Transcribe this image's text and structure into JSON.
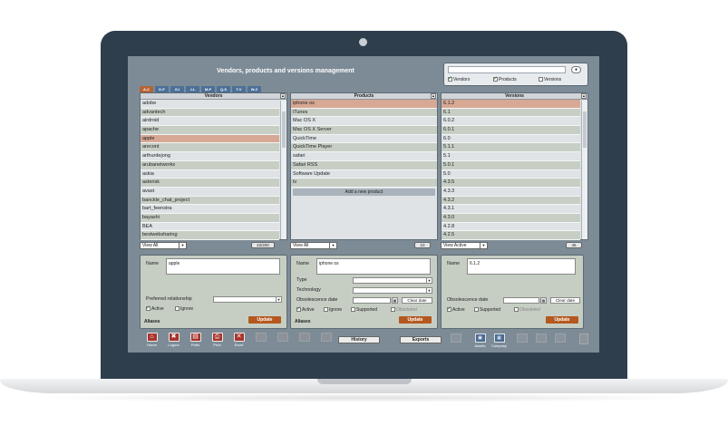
{
  "title": "Vendors, products and versions management",
  "search": {
    "go_label": "Go",
    "checks": [
      {
        "label": "Vendors",
        "checked": true
      },
      {
        "label": "Products",
        "checked": true
      },
      {
        "label": "Versions",
        "checked": false
      }
    ]
  },
  "alpha_tabs": [
    "A-C",
    "D-F",
    "G-I",
    "J-L",
    "M-P",
    "Q-S",
    "T-V",
    "W-Z"
  ],
  "vendors": {
    "header": "Vendors",
    "items": [
      "adobe",
      "advantech",
      "airdroid",
      "apache",
      "apple",
      "arecont",
      "arthurdejong",
      "arubanetworks",
      "askia",
      "asterisk",
      "avast",
      "banckle_chat_project",
      "bart_feenstra",
      "bayashi",
      "BEA",
      "bestwebsharing"
    ],
    "selected": "apple",
    "filter": "View All",
    "count": "42/200"
  },
  "products": {
    "header": "Products",
    "items": [
      "iphone os",
      "iTunes",
      "Mac OS X",
      "Mac OS X Server",
      "QuickTime",
      "QuickTime Player",
      "safari",
      "Safari RSS",
      "Software Update",
      "tv"
    ],
    "selected": "iphone os",
    "add_label": "Add a new product",
    "filter": "View All",
    "count": "10"
  },
  "versions": {
    "header": "Versions",
    "items": [
      "6.1.2",
      "6.1",
      "6.0.2",
      "6.0.1",
      "6.0",
      "5.1.1",
      "5.1",
      "5.0.1",
      "5.0",
      "4.3.5",
      "4.3.3",
      "4.3.2",
      "4.3.1",
      "4.3.0",
      "4.2.8",
      "4.2.5"
    ],
    "selected": "6.1.2",
    "filter": "View Active",
    "count": "46"
  },
  "vendor_form": {
    "name_label": "Name",
    "name_value": "apple",
    "pref_label": "Preferred relationship",
    "active_label": "Active",
    "ignore_label": "Ignore",
    "aliases_label": "Aliases",
    "update_label": "Update"
  },
  "product_form": {
    "name_label": "Name",
    "name_value": "iphone os",
    "type_label": "Type",
    "tech_label": "Technology",
    "obs_label": "Obsolescence date",
    "clear_label": "Clear date",
    "active_label": "Active",
    "ignore_label": "Ignore",
    "supported_label": "Supported",
    "obsoleted_label": "Obsoleted",
    "aliases_label": "Aliases",
    "update_label": "Update"
  },
  "version_form": {
    "name_label": "Name",
    "name_value": "6.1.2",
    "obs_label": "Obsolescence date",
    "clear_label": "Clear date",
    "active_label": "Active",
    "supported_label": "Supported",
    "obsoleted_label": "Obsoleted",
    "update_label": "Update"
  },
  "toolbar": {
    "buttons": [
      {
        "label": "Home",
        "icon": "home-icon",
        "enabled": true
      },
      {
        "label": "Logout",
        "icon": "logout-icon",
        "enabled": true
      },
      {
        "label": "Prefs",
        "icon": "prefs-icon",
        "enabled": true
      },
      {
        "label": "Print",
        "icon": "print-icon",
        "enabled": true
      },
      {
        "label": "Excel",
        "icon": "excel-icon",
        "enabled": true
      },
      {
        "label": "",
        "icon": "disabled-icon",
        "enabled": false
      },
      {
        "label": "",
        "icon": "disabled-icon",
        "enabled": false
      },
      {
        "label": "",
        "icon": "disabled-icon",
        "enabled": false
      },
      {
        "label": "",
        "icon": "disabled-icon",
        "enabled": false
      }
    ],
    "history_label": "History",
    "exports_label": "Exports",
    "right_buttons": [
      {
        "label": "Assets",
        "icon": "assets-icon",
        "enabled": true
      },
      {
        "label": "Company",
        "icon": "company-icon",
        "enabled": true
      }
    ]
  },
  "colors": {
    "accent": "#b5581f",
    "active_tab": "#b56434",
    "tab": "#4a6f98",
    "screen_bg": "#7d8b96",
    "laptop_frame": "#2f3e4d"
  }
}
